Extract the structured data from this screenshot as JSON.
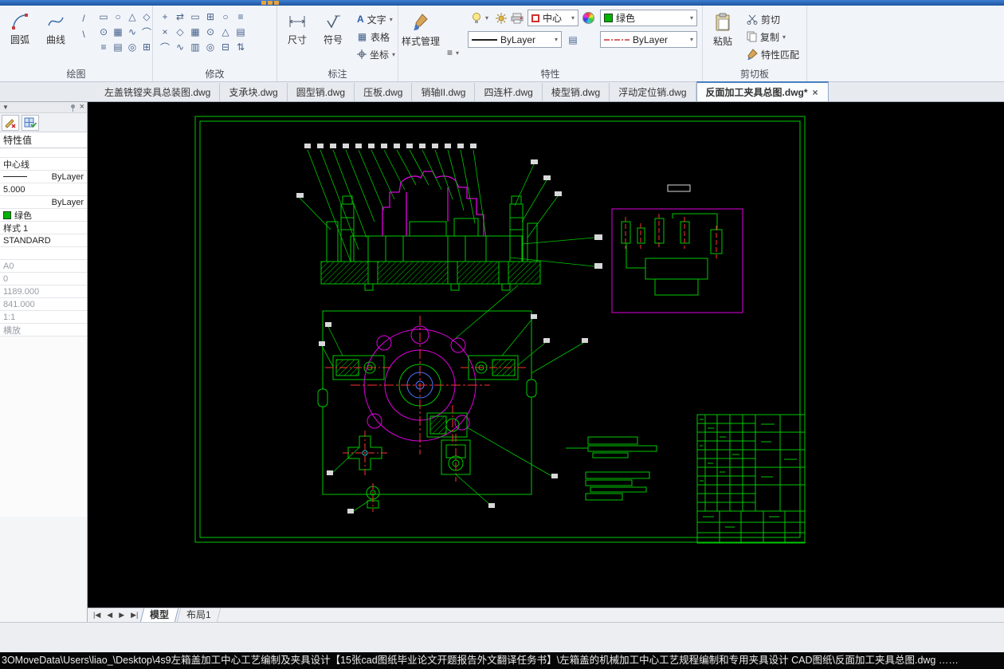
{
  "window": {
    "statusbar_path": "3OMoveData\\Users\\liao_\\Desktop\\4s9左箱盖加工中心工艺编制及夹具设计【15张cad图纸毕业论文开题报告外文翻译任务书】\\左箱盖的机械加工中心工艺规程编制和专用夹具设计 CAD图纸\\反面加工夹具总图.dwg ……"
  },
  "ribbon": {
    "draw_grid": [
      "▭",
      "○",
      "△",
      "◇",
      "⊙",
      "▦",
      "∿",
      "⌒",
      "≡",
      "▤",
      "◎",
      "⊞"
    ],
    "draw_lines": [
      "/",
      "\\"
    ],
    "modify_grid": [
      "+",
      "⇄",
      "▭",
      "⊞",
      "○",
      "≡",
      "×",
      "◇",
      "▦",
      "⊙",
      "△",
      "▤",
      "⌒",
      "∿",
      "▥",
      "◎",
      "⊟",
      "⇅"
    ],
    "panels": {
      "draw": {
        "label": "绘图",
        "arc": "圆弧",
        "spline": "曲线"
      },
      "modify": {
        "label": "修改"
      },
      "annotate": {
        "label": "标注",
        "dimension": "尺寸",
        "symbol": "符号",
        "text": "文字",
        "table": "表格",
        "coordinate": "坐标"
      },
      "properties": {
        "label": "特性",
        "style_manager": "样式管理",
        "menu_icon": "≡",
        "layer_value": "中心",
        "color_value": "绿色",
        "linetype_value": "ByLayer",
        "linewidth_value": "ByLayer"
      },
      "clipboard": {
        "label": "剪切板",
        "paste": "粘贴",
        "cut": "剪切",
        "copy": "复制",
        "match_properties": "特性匹配"
      }
    }
  },
  "doc_tabs": [
    {
      "label": "左盖铣镗夹具总装图.dwg"
    },
    {
      "label": "支承块.dwg"
    },
    {
      "label": "圆型销.dwg"
    },
    {
      "label": "压板.dwg"
    },
    {
      "label": "销轴II.dwg"
    },
    {
      "label": "四连杆.dwg"
    },
    {
      "label": "棱型销.dwg"
    },
    {
      "label": "浮动定位销.dwg"
    },
    {
      "label": "反面加工夹具总图.dwg*",
      "active": true,
      "close": "×"
    }
  ],
  "properties_panel": {
    "title": "特性值",
    "rows": [
      {
        "text": "中心线"
      },
      {
        "text": "ByLayer",
        "sample": "line"
      },
      {
        "text": "5.000"
      },
      {
        "text": "ByLayer",
        "align": "right"
      },
      {
        "text": "绿色",
        "sample": "green"
      },
      {
        "text": "样式 1"
      },
      {
        "text": "STANDARD"
      },
      {
        "text": ""
      },
      {
        "text": "A0",
        "muted": true
      },
      {
        "text": "0",
        "muted": true
      },
      {
        "text": "1189.000",
        "muted": true
      },
      {
        "text": "841.000",
        "muted": true
      },
      {
        "text": "1:1",
        "muted": true
      },
      {
        "text": "横放",
        "muted": true
      }
    ]
  },
  "model_tabs": {
    "model": "模型",
    "layout1": "布局1"
  },
  "colors": {
    "cad_green": "#00c800",
    "cad_magenta": "#e000e0",
    "cad_red": "#ff3232",
    "cad_blue": "#4878ff"
  }
}
